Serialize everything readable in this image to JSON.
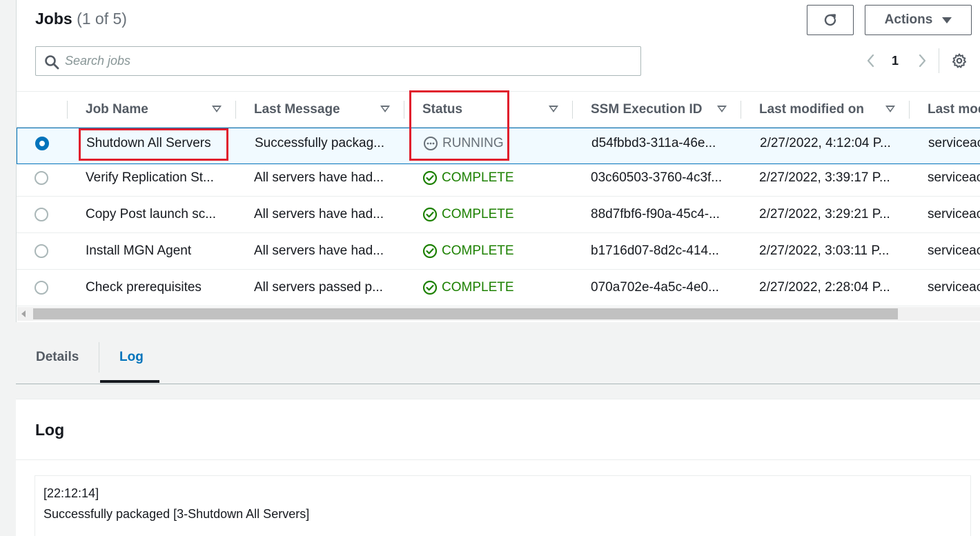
{
  "header": {
    "title": "Jobs",
    "count": "(1 of 5)",
    "actions_label": "Actions",
    "search_placeholder": "Search jobs",
    "page_number": "1"
  },
  "table": {
    "columns": [
      "Job Name",
      "Last Message",
      "Status",
      "SSM Execution ID",
      "Last modified on",
      "Last mod"
    ],
    "rows": [
      {
        "selected": true,
        "job_name": "Shutdown All Servers",
        "last_message": "Successfully packag...",
        "status": "RUNNING",
        "ssm_id": "d54fbbd3-311a-46e...",
        "modified_on": "2/27/2022, 4:12:04 P...",
        "modified_by": "serviceac"
      },
      {
        "selected": false,
        "job_name": "Verify Replication St...",
        "last_message": "All servers have had...",
        "status": "COMPLETE",
        "ssm_id": "03c60503-3760-4c3f...",
        "modified_on": "2/27/2022, 3:39:17 P...",
        "modified_by": "serviceac"
      },
      {
        "selected": false,
        "job_name": "Copy Post launch sc...",
        "last_message": "All servers have had...",
        "status": "COMPLETE",
        "ssm_id": "88d7fbf6-f90a-45c4-...",
        "modified_on": "2/27/2022, 3:29:21 P...",
        "modified_by": "serviceac"
      },
      {
        "selected": false,
        "job_name": "Install MGN Agent",
        "last_message": "All servers have had...",
        "status": "COMPLETE",
        "ssm_id": "b1716d07-8d2c-414...",
        "modified_on": "2/27/2022, 3:03:11 P...",
        "modified_by": "serviceac"
      },
      {
        "selected": false,
        "job_name": "Check prerequisites",
        "last_message": "All servers passed p...",
        "status": "COMPLETE",
        "ssm_id": "070a702e-4a5c-4e0...",
        "modified_on": "2/27/2022, 2:28:04 P...",
        "modified_by": "serviceac"
      }
    ]
  },
  "tabs": [
    {
      "label": "Details",
      "active": false
    },
    {
      "label": "Log",
      "active": true
    }
  ],
  "log": {
    "title": "Log",
    "timestamp": "[22:12:14]",
    "message": "Successfully packaged [3-Shutdown All Servers]"
  },
  "colors": {
    "accent": "#0073bb",
    "complete": "#1d8102",
    "running": "#687078",
    "highlight": "#e01e2d"
  }
}
